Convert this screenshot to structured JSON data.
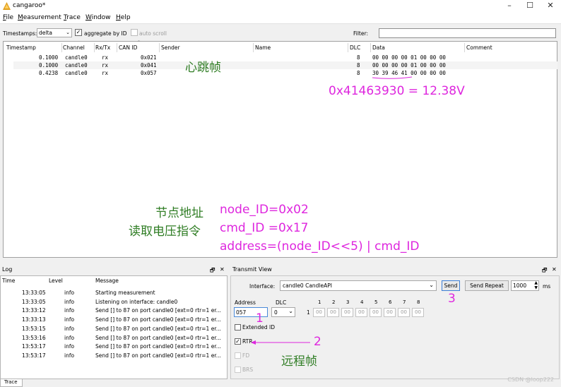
{
  "window": {
    "title": "cangaroo*",
    "minimize": "–",
    "maximize": "☐",
    "close": "✕"
  },
  "menu": [
    "File",
    "Measurement",
    "Trace",
    "Window",
    "Help"
  ],
  "toolbar": {
    "timestamps_label": "Timestamps:",
    "timestamps_value": "delta",
    "aggregate_label": "aggregate by ID",
    "aggregate_checked": true,
    "autoscroll_label": "auto scroll",
    "filter_label": "Filter:"
  },
  "trace": {
    "columns": [
      "Timestamp",
      "Channel",
      "Rx/Tx",
      "CAN ID",
      "Sender",
      "Name",
      "DLC",
      "Data",
      "Comment"
    ],
    "rows": [
      {
        "timestamp": "0.1000",
        "channel": "candle0",
        "rxtx": "rx",
        "can_id": "0x021",
        "dlc": "8",
        "data": "00 00 00 00 01 00 00 00"
      },
      {
        "timestamp": "0.1000",
        "channel": "candle0",
        "rxtx": "rx",
        "can_id": "0x041",
        "dlc": "8",
        "data": "00 00 00 00 01 00 00 00"
      },
      {
        "timestamp": "0.4238",
        "channel": "candle0",
        "rxtx": "rx",
        "can_id": "0x057",
        "dlc": "8",
        "data": "30 39 46 41 00 00 00 00"
      }
    ]
  },
  "annotations": {
    "heartbeat": "心跳帧",
    "voltage": "0x41463930 = 12.38V",
    "node_addr_label": "节点地址",
    "node_id": "node_ID=0x02",
    "read_voltage_label": "读取电压指令",
    "cmd_id": "cmd_ID =0x17",
    "address_formula": "address=(node_ID<<5) | cmd_ID",
    "num1": "1",
    "num2": "2",
    "num3": "3",
    "remote_frame": "远程帧"
  },
  "log": {
    "title": "Log",
    "columns": [
      "Time",
      "Level",
      "Message"
    ],
    "rows": [
      {
        "time": "13:33:05",
        "level": "info",
        "message": "Starting measurement"
      },
      {
        "time": "13:33:05",
        "level": "info",
        "message": "Listening on interface: candle0"
      },
      {
        "time": "13:33:12",
        "level": "info",
        "message": "Send [] to 87 on port candle0 [ext=0 rtr=1 er..."
      },
      {
        "time": "13:33:13",
        "level": "info",
        "message": "Send [] to 87 on port candle0 [ext=0 rtr=1 er..."
      },
      {
        "time": "13:53:15",
        "level": "info",
        "message": "Send [] to 87 on port candle0 [ext=0 rtr=1 er..."
      },
      {
        "time": "13:53:16",
        "level": "info",
        "message": "Send [] to 87 on port candle0 [ext=0 rtr=1 er..."
      },
      {
        "time": "13:53:17",
        "level": "info",
        "message": "Send [] to 87 on port candle0 [ext=0 rtr=1 er..."
      },
      {
        "time": "13:53:17",
        "level": "info",
        "message": "Send [] to 87 on port candle0 [ext=0 rtr=1 er..."
      }
    ]
  },
  "transmit": {
    "title": "Transmit View",
    "interface_label": "Interface:",
    "interface_value": "candle0 CandleAPI",
    "send": "Send",
    "send_repeat": "Send Repeat",
    "repeat_ms": "1000",
    "ms_unit": "ms",
    "address_label": "Address",
    "address_value": "057",
    "dlc_label": "DLC",
    "dlc_value": "0",
    "byte_headers": [
      "1",
      "2",
      "3",
      "4",
      "5",
      "6",
      "7",
      "8"
    ],
    "row_label": "1",
    "byte_values": [
      "00",
      "00",
      "00",
      "00",
      "00",
      "00",
      "00",
      "00"
    ],
    "extended_id": "Extended ID",
    "rtr": "RTR",
    "rtr_checked": true,
    "fd": "FD",
    "brs": "BRS"
  },
  "bottom_tab": "Trace",
  "watermark": "CSDN @loop222",
  "panel_icons": {
    "float": "🗗",
    "close": "✕"
  }
}
